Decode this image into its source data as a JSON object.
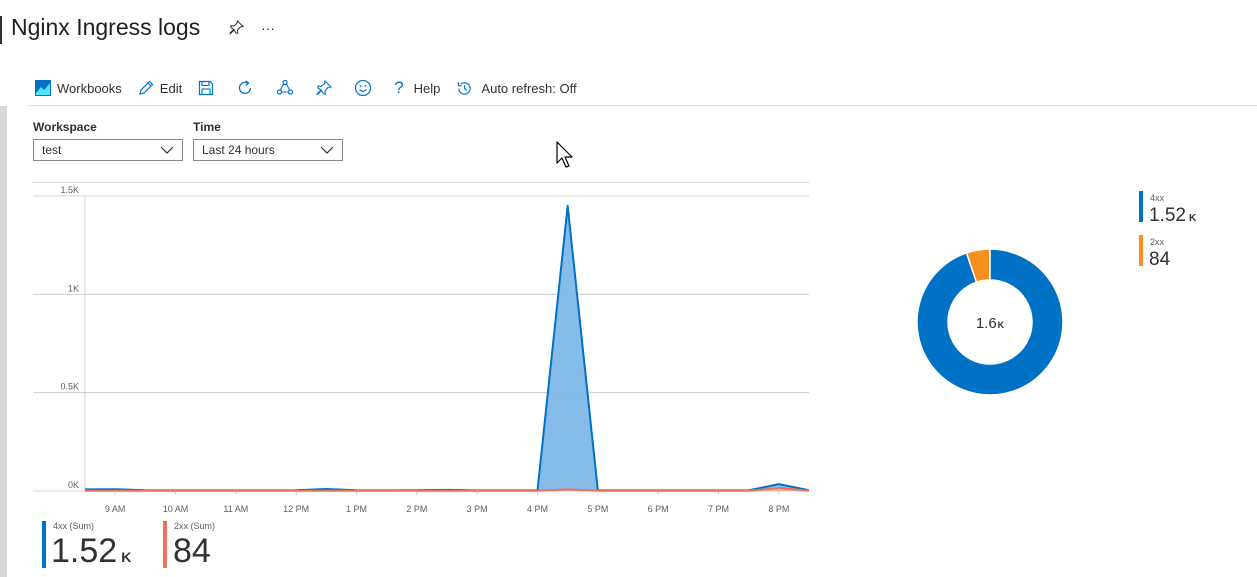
{
  "header": {
    "title": "Nginx Ingress logs",
    "pin_icon": "pin-icon",
    "more_icon": "more-icon",
    "more_glyph": "···"
  },
  "toolbar": {
    "workbooks_label": "Workbooks",
    "edit_label": "Edit",
    "help_label": "Help",
    "auto_refresh_label": "Auto refresh: Off"
  },
  "params": {
    "workspace_label": "Workspace",
    "workspace_value": "test",
    "time_label": "Time",
    "time_value": "Last 24 hours"
  },
  "colors": {
    "blue": "#0072c6",
    "blue_fill": "#7fb8e8",
    "orange": "#f7901e",
    "salmon": "#e8735a",
    "text": "#323130"
  },
  "chart_data": [
    {
      "type": "area",
      "title": "",
      "xlabel": "",
      "ylabel": "",
      "x_ticks": [
        "9 AM",
        "10 AM",
        "11 AM",
        "12 PM",
        "1 PM",
        "2 PM",
        "3 PM",
        "4 PM",
        "5 PM",
        "6 PM",
        "7 PM",
        "8 PM"
      ],
      "y_ticks": [
        "1.5K",
        "1K",
        "0.5K",
        "0K"
      ],
      "x_hours": [
        8.5,
        9,
        9.5,
        10,
        10.5,
        11,
        11.5,
        12,
        12.5,
        13,
        13.5,
        14,
        14.5,
        15,
        15.5,
        16,
        16.5,
        17,
        17.5,
        18,
        18.5,
        19,
        19.5,
        20,
        20.5
      ],
      "ylim": [
        0,
        1500
      ],
      "grid": true,
      "series": [
        {
          "name": "4xx (Sum)",
          "color": "#0072c6",
          "fill": "#7fb8e8",
          "values": [
            8,
            9,
            4,
            3,
            3,
            3,
            3,
            4,
            10,
            4,
            3,
            4,
            6,
            3,
            3,
            3,
            1450,
            3,
            3,
            3,
            3,
            3,
            3,
            35,
            4
          ]
        },
        {
          "name": "2xx (Sum)",
          "color": "#e8735a",
          "fill": "#f4b5a5",
          "values": [
            1,
            1,
            1,
            1,
            1,
            1,
            1,
            1,
            1,
            1,
            1,
            1,
            1,
            1,
            1,
            1,
            8,
            1,
            1,
            1,
            1,
            1,
            1,
            15,
            1
          ]
        }
      ],
      "legend": [
        {
          "name": "4xx (Sum)",
          "value": "1.52",
          "unit": "K",
          "color": "#0072c6"
        },
        {
          "name": "2xx (Sum)",
          "value": "84",
          "unit": "",
          "color": "#e8735a"
        }
      ]
    },
    {
      "type": "pie",
      "center_value": "1.6",
      "center_unit": "K",
      "slices": [
        {
          "name": "4xx",
          "value": 1520,
          "label": "1.52",
          "unit": "K",
          "color": "#0072c6"
        },
        {
          "name": "2xx",
          "value": 84,
          "label": "84",
          "unit": "",
          "color": "#f7901e"
        }
      ]
    }
  ]
}
